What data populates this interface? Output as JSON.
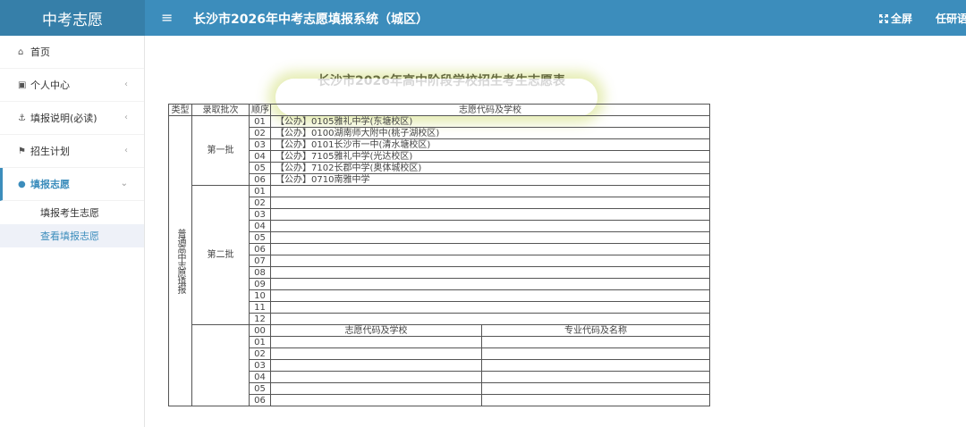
{
  "header": {
    "logo": "中考志愿",
    "menu_toggle": "≡",
    "system_title": "长沙市2026年中考志愿填报系统（城区）",
    "fullscreen_label": "全屏",
    "user_name": "任研语"
  },
  "sidebar": {
    "items": [
      {
        "label": "首页",
        "icon": "home-icon"
      },
      {
        "label": "个人中心",
        "icon": "id-card-icon"
      },
      {
        "label": "填报说明(必读)",
        "icon": "anchor-icon"
      },
      {
        "label": "招生计划",
        "icon": "flag-icon"
      },
      {
        "label": "填报志愿",
        "icon": "user-icon"
      }
    ],
    "sub_items": [
      {
        "label": "填报考生志愿"
      },
      {
        "label": "查看填报志愿"
      }
    ]
  },
  "form": {
    "title": "长沙市2026年高中阶段学校招生考生志愿表",
    "headers": {
      "type": "类型",
      "batch": "录取批次",
      "order": "顺序",
      "school": "志愿代码及学校"
    },
    "type_label": "普通高中志愿填报",
    "batch1": {
      "label": "第一批",
      "rows": [
        {
          "order": "01",
          "school": "【公办】0105雅礼中学(东塘校区)"
        },
        {
          "order": "02",
          "school": "【公办】0100湖南师大附中(桃子湖校区)"
        },
        {
          "order": "03",
          "school": "【公办】0101长沙市一中(清水塘校区)"
        },
        {
          "order": "04",
          "school": "【公办】7105雅礼中学(光达校区)"
        },
        {
          "order": "05",
          "school": "【公办】7102长郡中学(奥体城校区)"
        },
        {
          "order": "06",
          "school": "【公办】0710南雅中学"
        }
      ]
    },
    "batch2": {
      "label": "第二批",
      "orders": [
        "01",
        "02",
        "03",
        "04",
        "05",
        "06",
        "07",
        "08",
        "09",
        "10",
        "11",
        "12"
      ]
    },
    "batch3": {
      "header_order": "00",
      "col_school": "志愿代码及学校",
      "col_major": "专业代码及名称",
      "orders": [
        "01",
        "02",
        "03",
        "04",
        "05",
        "06"
      ]
    }
  }
}
